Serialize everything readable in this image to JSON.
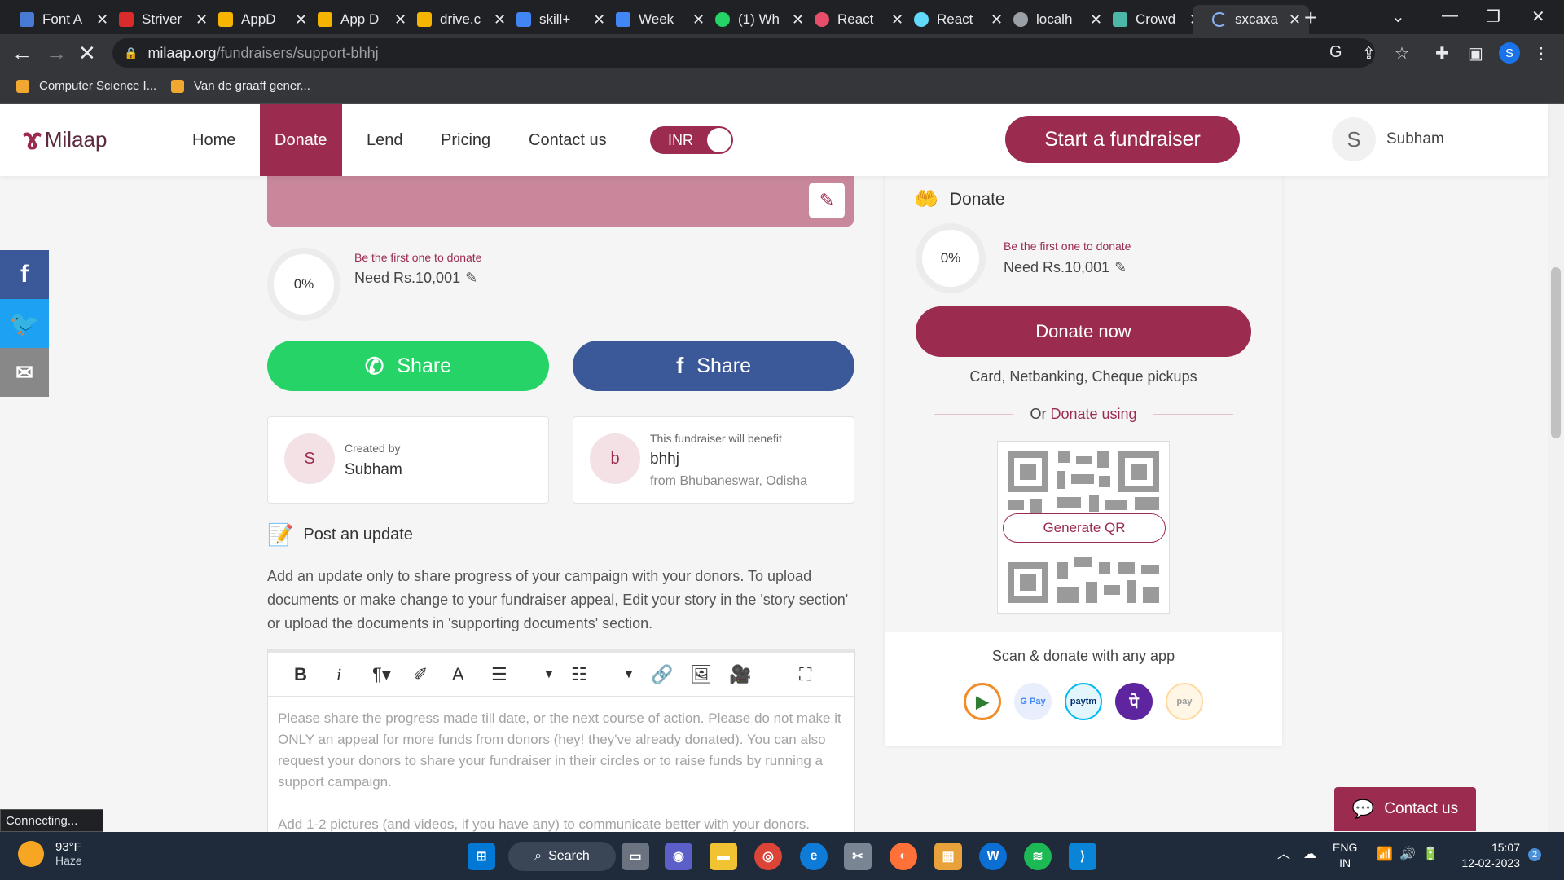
{
  "browser": {
    "tabs": [
      {
        "title": "Font A",
        "color": "#4a7bd4"
      },
      {
        "title": "Striver",
        "color": "#d92b2b"
      },
      {
        "title": "AppD",
        "color": "#f4b400"
      },
      {
        "title": "App D",
        "color": "#f4b400"
      },
      {
        "title": "drive.c",
        "color": "#f4b400"
      },
      {
        "title": "skill+",
        "color": "#4285f4"
      },
      {
        "title": "Week",
        "color": "#4285f4"
      },
      {
        "title": "(1) Wh",
        "color": "#25d366"
      },
      {
        "title": "React",
        "color": "#e84d6a"
      },
      {
        "title": "React",
        "color": "#61dafb"
      },
      {
        "title": "localh",
        "color": "#9aa0a6"
      },
      {
        "title": "Crowd",
        "color": "#4ab7a9"
      },
      {
        "title": "sxcaxa",
        "color": "#8ab4f8"
      }
    ],
    "url_host": "milaap.org",
    "url_path": "/fundraisers/support-bhhj",
    "profile_initial": "S",
    "bookmarks": [
      "Computer Science I...",
      "Van de graaff gener..."
    ],
    "status_text": "Connecting..."
  },
  "header": {
    "logo_text": "Milaap",
    "nav": [
      "Home",
      "Donate",
      "Lend",
      "Pricing",
      "Contact us"
    ],
    "currency": "INR",
    "start_button": "Start a fundraiser",
    "user_initial": "S",
    "user_name": "Subham"
  },
  "progress": {
    "percent_label": "0%",
    "percent_value": 0,
    "first_text": "Be the first one to donate",
    "need_text": "Need Rs.10,001"
  },
  "share": {
    "whatsapp_label": "Share",
    "facebook_label": "Share"
  },
  "creator": {
    "initial": "S",
    "label": "Created by",
    "name": "Subham"
  },
  "beneficiary": {
    "initial": "b",
    "label": "This fundraiser will benefit",
    "name": "bhhj",
    "location": "from Bhubaneswar, Odisha"
  },
  "post_update": {
    "title": "Post an update",
    "description": "Add an update only to share progress of your campaign with your donors. To upload documents or make change to your fundraiser appeal, Edit your story in the 'story section' or upload the documents in 'supporting documents' section.",
    "placeholder_p1": "Please share the progress made till date, or the next course of action. Please do not make it ONLY an appeal for more funds from donors (hey! they've already donated). You can also request your donors to share your fundraiser in their circles or to raise funds by running a support campaign.",
    "placeholder_p2": "Add 1-2 pictures (and videos, if you have any) to communicate better with your donors."
  },
  "sidebar": {
    "heading": "Donate",
    "donate_now": "Donate now",
    "methods": "Card, Netbanking, Cheque pickups",
    "or_text": "Or",
    "donate_using": "Donate using",
    "generate_qr": "Generate QR",
    "scan_text": "Scan & donate with any app",
    "apps": [
      "bhim-icon",
      "gpay-icon",
      "paytm-icon",
      "phonepe-icon",
      "amazon-pay-icon"
    ]
  },
  "contact_float": "Contact us",
  "taskbar": {
    "temp": "93°F",
    "condition": "Haze",
    "search": "Search",
    "lang_top": "ENG",
    "lang_bottom": "IN",
    "time": "15:07",
    "date": "12-02-2023",
    "notif_count": "2"
  },
  "colors": {
    "brand": "#9c2c4f",
    "whatsapp": "#25d366",
    "facebook": "#3b5998",
    "twitter": "#1da1f2",
    "email": "#888888"
  }
}
